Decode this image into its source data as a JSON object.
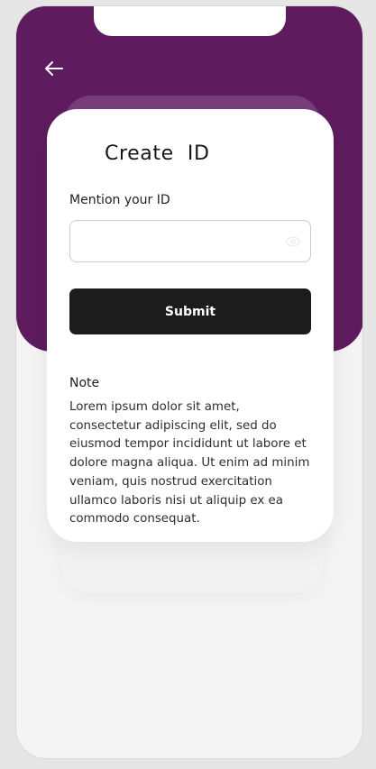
{
  "header": {
    "back_icon": "arrow-left-icon"
  },
  "form": {
    "title": "Create  ID",
    "field_label": "Mention your ID",
    "input_value": "",
    "input_placeholder": "",
    "visibility_icon": "eye-icon",
    "submit_label": "Submit"
  },
  "note": {
    "title": "Note",
    "text": "Lorem ipsum dolor sit amet, consectetur adipiscing elit, sed do eiusmod tempor incididunt ut labore et dolore magna aliqua. Ut enim ad minim veniam, quis nostrud exercitation ullamco laboris nisi ut aliquip ex ea commodo consequat."
  },
  "colors": {
    "header_background": "#5e1c5e",
    "card_background": "#ffffff",
    "button_background": "#1c1c1c",
    "page_background": "#f4f4f4",
    "text_primary": "#171717"
  }
}
